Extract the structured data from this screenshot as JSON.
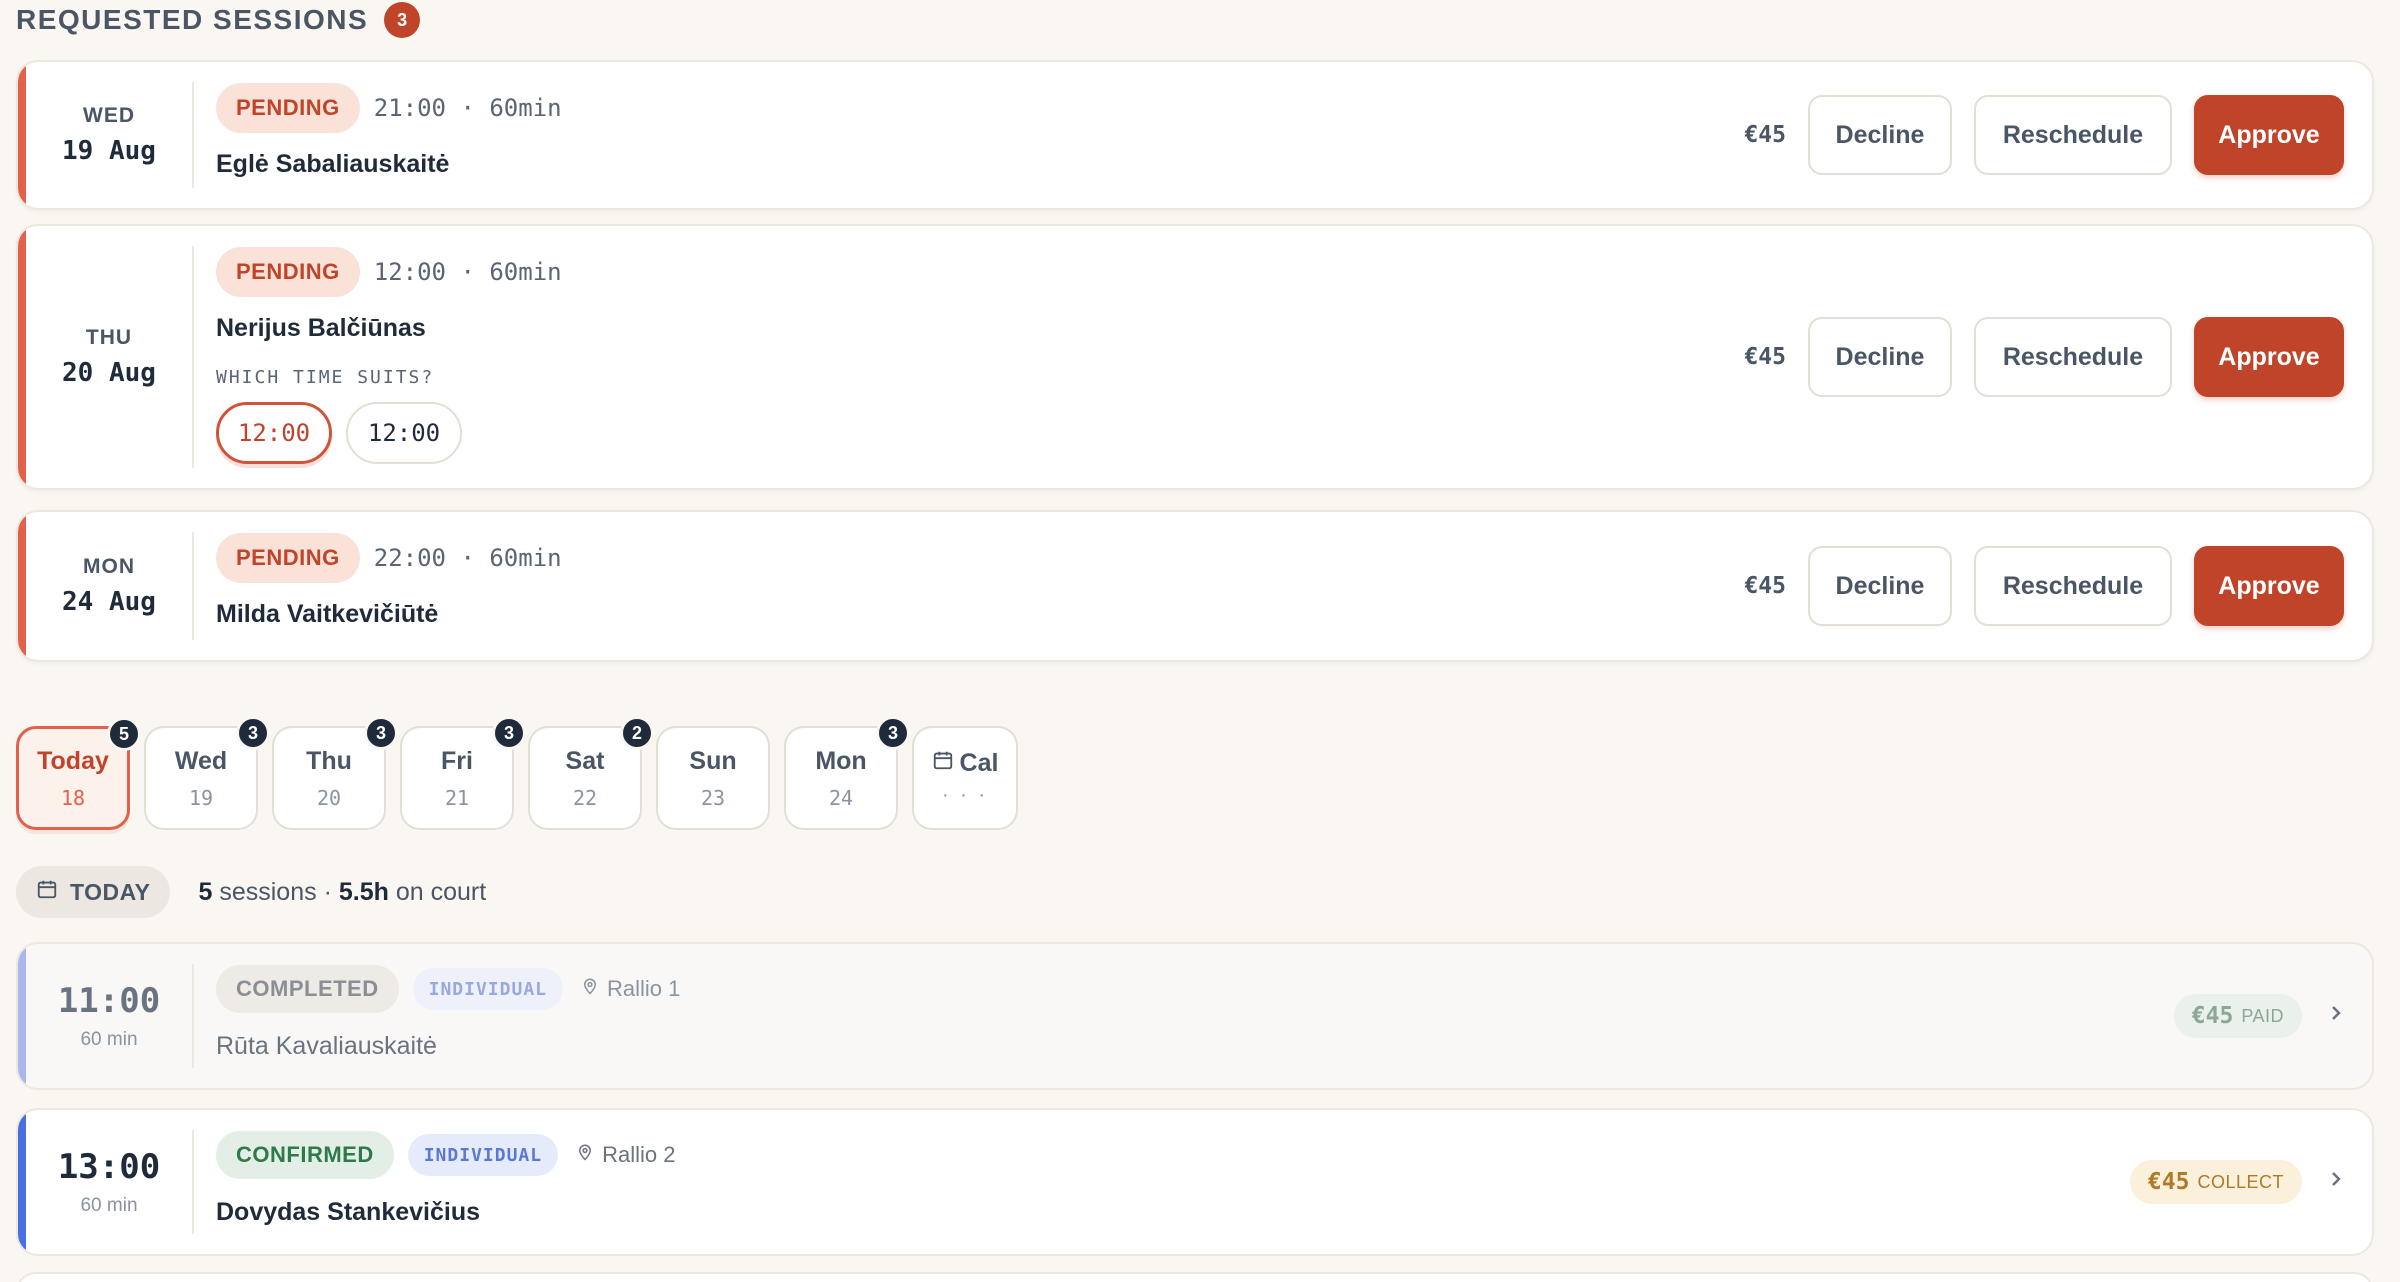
{
  "requested": {
    "title": "REQUESTED SESSIONS",
    "count": "3",
    "items": [
      {
        "dow": "WED",
        "date": "19 Aug",
        "status": "PENDING",
        "time_info": "21:00 · 60min",
        "name": "Eglė Sabaliauskaitė",
        "price": "€45",
        "decline": "Decline",
        "reschedule": "Reschedule",
        "approve": "Approve"
      },
      {
        "dow": "THU",
        "date": "20 Aug",
        "status": "PENDING",
        "time_info": "12:00 · 60min",
        "name": "Nerijus Balčiūnas",
        "question": "WHICH TIME SUITS?",
        "options": [
          "12:00",
          "12:00"
        ],
        "price": "€45",
        "decline": "Decline",
        "reschedule": "Reschedule",
        "approve": "Approve"
      },
      {
        "dow": "MON",
        "date": "24 Aug",
        "status": "PENDING",
        "time_info": "22:00 · 60min",
        "name": "Milda Vaitkevičiūtė",
        "price": "€45",
        "decline": "Decline",
        "reschedule": "Reschedule",
        "approve": "Approve"
      }
    ]
  },
  "days": [
    {
      "name": "Today",
      "num": "18",
      "badge": "5",
      "active": true
    },
    {
      "name": "Wed",
      "num": "19",
      "badge": "3"
    },
    {
      "name": "Thu",
      "num": "20",
      "badge": "3"
    },
    {
      "name": "Fri",
      "num": "21",
      "badge": "3"
    },
    {
      "name": "Sat",
      "num": "22",
      "badge": "2"
    },
    {
      "name": "Sun",
      "num": "23",
      "badge": ""
    },
    {
      "name": "Mon",
      "num": "24",
      "badge": "3"
    }
  ],
  "calendar_chip": {
    "name": "Cal",
    "dots": "· · ·",
    "icon": "calendar-icon"
  },
  "today": {
    "label": "TODAY",
    "sessions_count": "5",
    "sessions_word": "sessions",
    "separator": "·",
    "hours": "5.5h",
    "hours_suffix": "on court"
  },
  "sessions": [
    {
      "time": "11:00",
      "duration": "60 min",
      "status": "COMPLETED",
      "type": "INDIVIDUAL",
      "location": "Rallio 1",
      "name": "Rūta Kavaliauskaitė",
      "amount": "€45",
      "pay_label": "PAID",
      "bar_color": "#aab6ec"
    },
    {
      "time": "13:00",
      "duration": "60 min",
      "status": "CONFIRMED",
      "type": "INDIVIDUAL",
      "location": "Rallio 2",
      "name": "Dovydas Stankevičius",
      "amount": "€45",
      "pay_label": "COLLECT",
      "bar_color": "#4a6fe0"
    }
  ],
  "colors": {
    "accent": "#c0442a",
    "pending_bar": "#e2614a",
    "background": "#faf7f2"
  }
}
